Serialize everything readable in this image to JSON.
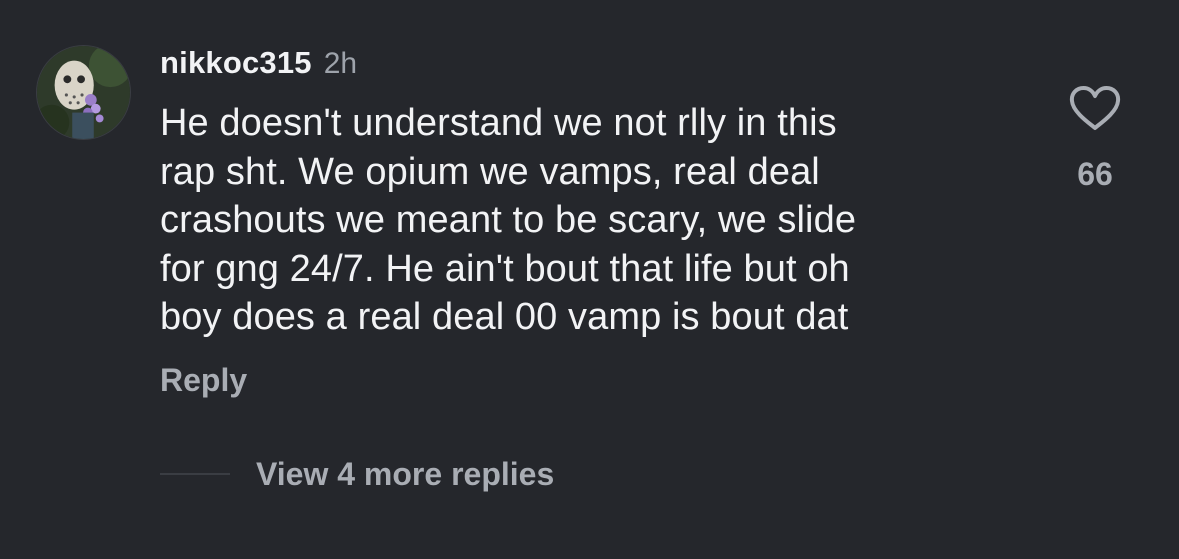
{
  "comment": {
    "username": "nikkoc315",
    "timestamp": "2h",
    "text_lines": [
      "He doesn't understand we not rlly in this",
      "rap sht. We opium we vamps, real deal",
      "crashouts we meant to be scary, we slide",
      "for gng 24/7. He ain't bout that life but oh",
      "boy does a real deal 00 vamp is bout dat"
    ],
    "reply_label": "Reply",
    "like_count": "66",
    "like_icon": "heart-outline-icon",
    "view_more_label": "View 4 more replies"
  },
  "colors": {
    "background": "#25272c",
    "primary_text": "#f2f3f5",
    "secondary_text": "#a9adb4"
  }
}
